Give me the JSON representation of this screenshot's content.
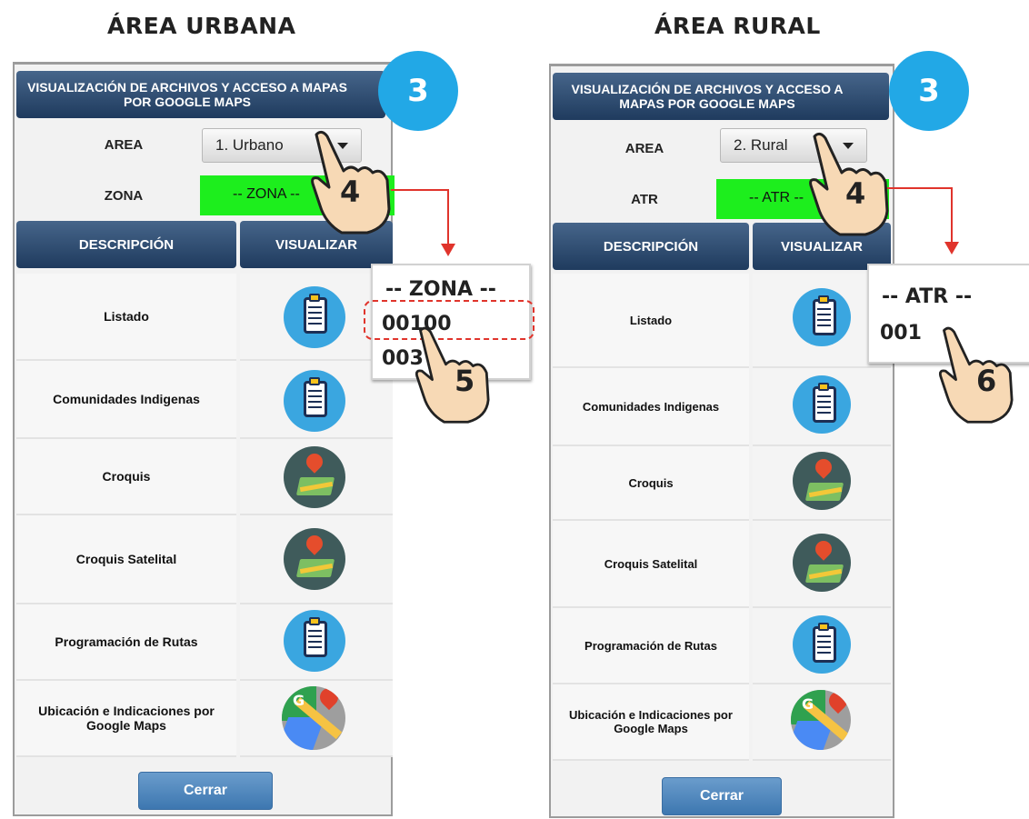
{
  "urban": {
    "heading": "ÁREA URBANA",
    "panel_title": "VISUALIZACIÓN DE ARCHIVOS Y ACCESO A MAPAS POR GOOGLE MAPS",
    "area_label": "AREA",
    "area_value": "1. Urbano",
    "second_label": "ZONA",
    "second_value": "-- ZONA --",
    "col_description": "DESCRIPCIÓN",
    "col_view": "VISUALIZAR",
    "items": [
      {
        "label": "Listado",
        "icon": "clipboard-icon"
      },
      {
        "label": "Comunidades Indigenas",
        "icon": "clipboard-icon"
      },
      {
        "label": "Croquis",
        "icon": "map-pin-icon"
      },
      {
        "label": "Croquis Satelital",
        "icon": "map-pin-icon"
      },
      {
        "label": "Programación de Rutas",
        "icon": "clipboard-icon"
      },
      {
        "label": "Ubicación e Indicaciones por Google Maps",
        "icon": "google-maps-icon"
      }
    ],
    "close_button": "Cerrar",
    "step_badge": "3",
    "hand_step_select": "4",
    "hand_step_option": "5",
    "popup": {
      "header": "-- ZONA --",
      "options": [
        "00100",
        "003"
      ]
    }
  },
  "rural": {
    "heading": "ÁREA RURAL",
    "panel_title": "VISUALIZACIÓN DE ARCHIVOS Y ACCESO A MAPAS POR GOOGLE MAPS",
    "area_label": "AREA",
    "area_value": "2. Rural",
    "second_label": "ATR",
    "second_value": "-- ATR --",
    "col_description": "DESCRIPCIÓN",
    "col_view": "VISUALIZAR",
    "items": [
      {
        "label": "Listado",
        "icon": "clipboard-icon"
      },
      {
        "label": "Comunidades Indigenas",
        "icon": "clipboard-icon"
      },
      {
        "label": "Croquis",
        "icon": "map-pin-icon"
      },
      {
        "label": "Croquis Satelital",
        "icon": "map-pin-icon"
      },
      {
        "label": "Programación de Rutas",
        "icon": "clipboard-icon"
      },
      {
        "label": "Ubicación e Indicaciones por Google Maps",
        "icon": "google-maps-icon"
      }
    ],
    "close_button": "Cerrar",
    "step_badge": "3",
    "hand_step_select": "4",
    "hand_step_option": "6",
    "popup": {
      "header": "-- ATR --",
      "options": [
        "001"
      ]
    }
  },
  "colors": {
    "header_blue": "#1f3b5e",
    "badge_blue": "#22a8e6",
    "green_field": "#1dee1d",
    "arrow_red": "#e0342c",
    "button_blue": "#3d77b0"
  }
}
